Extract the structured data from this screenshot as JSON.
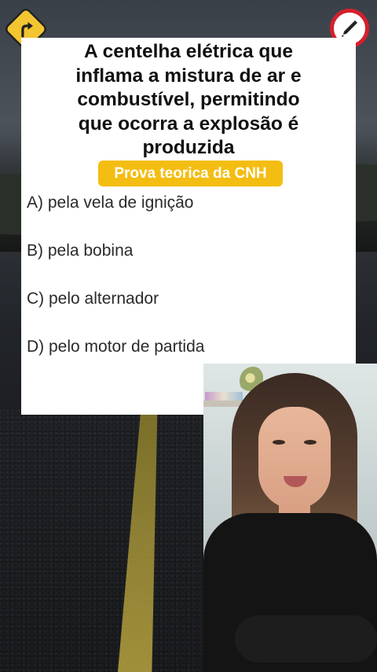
{
  "question": {
    "lines": [
      "A centelha elétrica que",
      "inflama a mistura de ar e",
      "combustível, permitindo",
      "que ocorra a explosão é",
      "produzida"
    ]
  },
  "badge": "Prova teorica da CNH",
  "options": [
    "A) pela vela de ignição",
    "B) pela bobina",
    "C) pelo alternador",
    "D) pelo motor de partida"
  ],
  "icons": {
    "left": "road-curve-sign-icon",
    "right": "edit-pencil-icon"
  },
  "colors": {
    "badge": "#f4bd12",
    "sign": "#f2c531",
    "pencil_ring": "#d4202d"
  }
}
